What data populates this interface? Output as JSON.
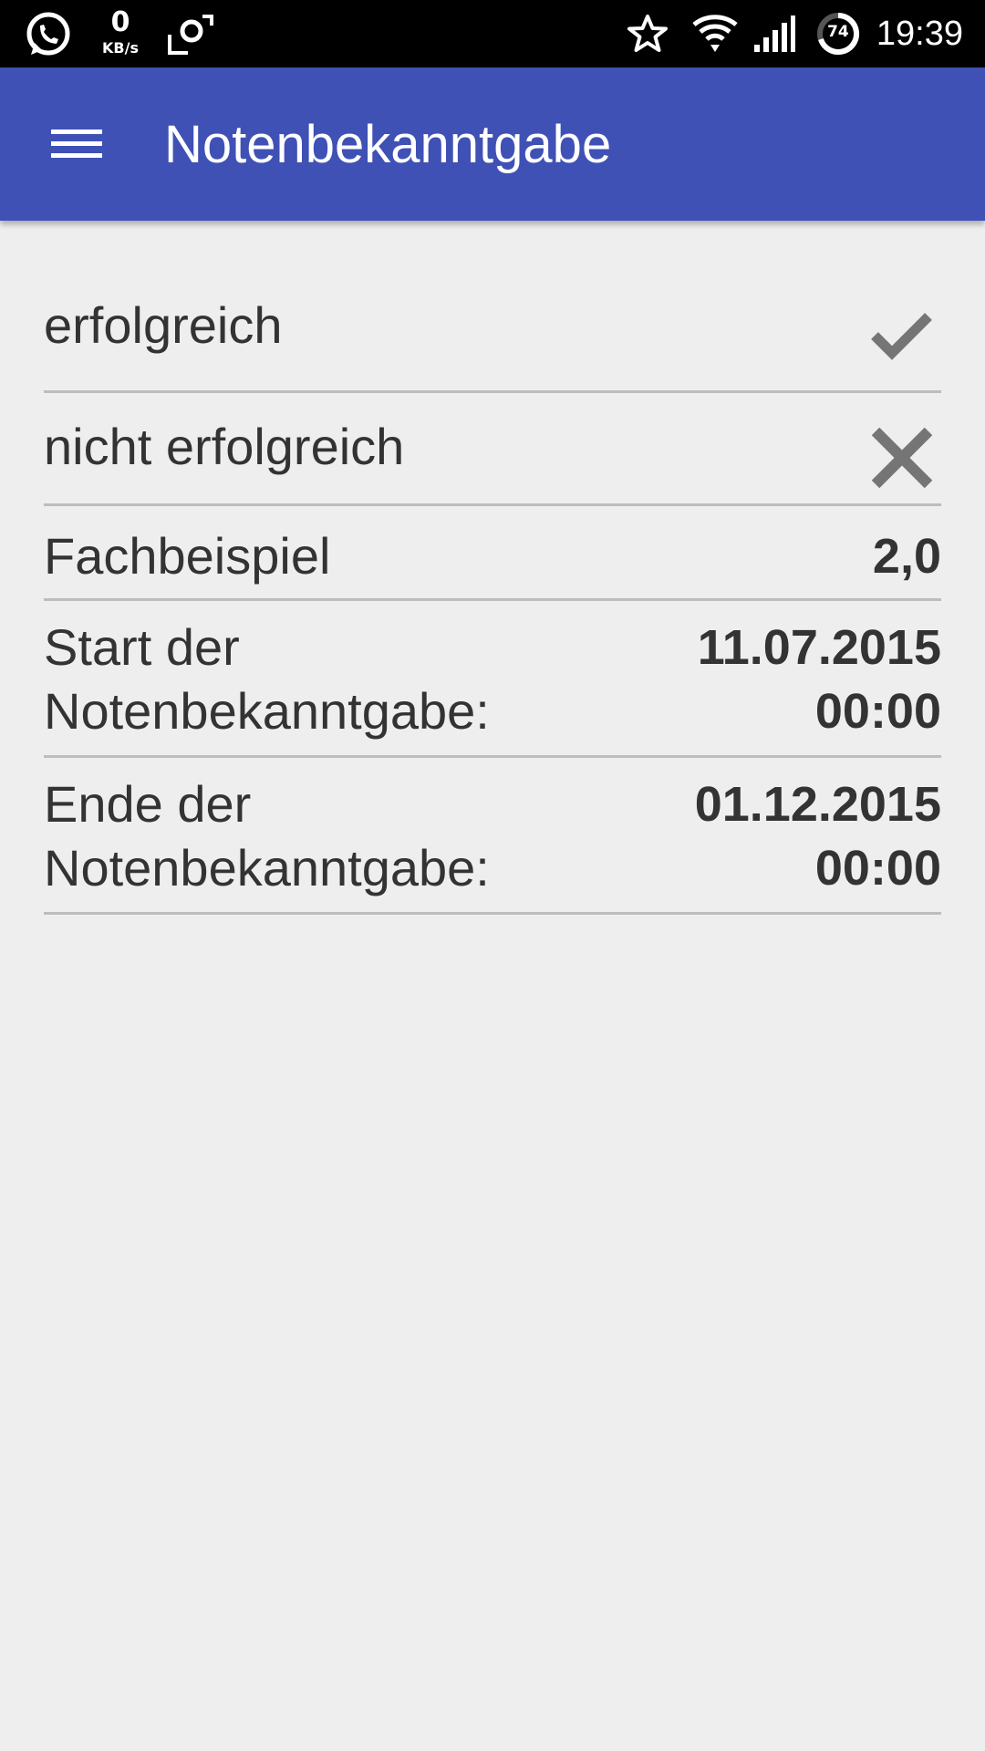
{
  "status_bar": {
    "kbs_value": "0",
    "kbs_unit": "KB/s",
    "battery_level": "74",
    "time": "19:39",
    "icons": [
      "whatsapp-icon",
      "data-speed",
      "screen-rotate-icon",
      "star-icon",
      "wifi-icon",
      "signal-icon",
      "battery-icon"
    ]
  },
  "app_bar": {
    "title": "Notenbekanntgabe",
    "background": "#3f51b5",
    "menu_icon": "hamburger-menu-icon"
  },
  "list": {
    "rows": [
      {
        "label": "erfolgreich",
        "icon": "checkmark-icon"
      },
      {
        "label": "nicht erfolgreich",
        "icon": "close-icon"
      },
      {
        "label": "Fachbeispiel",
        "value": "2,0"
      },
      {
        "label_line1": "Start der",
        "label_line2": "Notenbekanntgabe:",
        "value_line1": "11.07.2015",
        "value_line2": "00:00"
      },
      {
        "label_line1": "Ende der",
        "label_line2": "Notenbekanntgabe:",
        "value_line1": "01.12.2015",
        "value_line2": "00:00"
      }
    ]
  },
  "colors": {
    "background": "#eeeeee",
    "text": "#333333",
    "divider": "#bdbdbd",
    "icon": "#757575"
  }
}
